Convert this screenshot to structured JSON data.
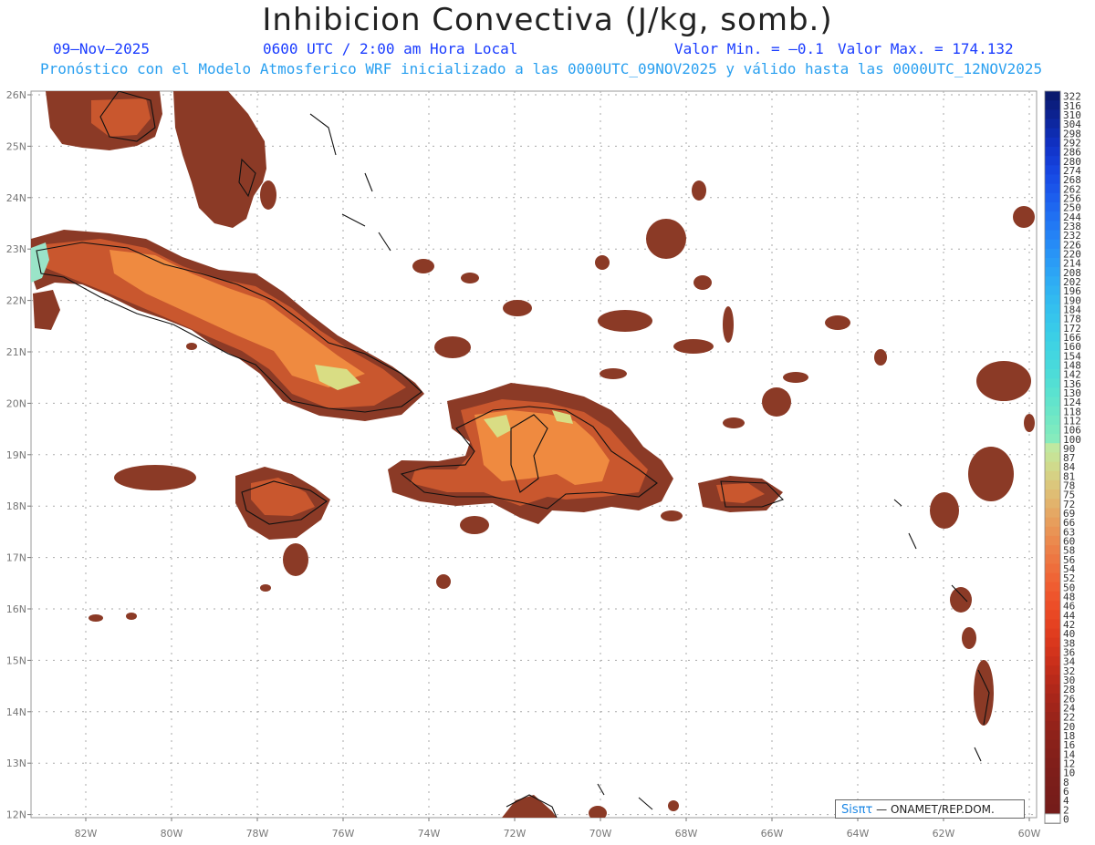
{
  "title": "Inhibicion Convectiva (J/kg, somb.)",
  "header": {
    "date": "09—Nov—2025",
    "time": "0600 UTC / 2:00 am Hora Local",
    "min": "Valor Min. = —0.1",
    "max": "Valor Max. = 174.132",
    "forecast": "Pronóstico con el Modelo Atmosferico WRF inicializado a las 0000UTC_09NOV2025 y válido hasta las  0000UTC_12NOV2025"
  },
  "axes": {
    "lat_labels": [
      "26N",
      "25N",
      "24N",
      "23N",
      "22N",
      "21N",
      "20N",
      "19N",
      "18N",
      "17N",
      "16N",
      "15N",
      "14N",
      "13N",
      "12N"
    ],
    "lon_labels": [
      "82W",
      "80W",
      "78W",
      "76W",
      "74W",
      "72W",
      "70W",
      "68W",
      "66W",
      "64W",
      "62W",
      "60W"
    ]
  },
  "colorbar": {
    "labels": [
      "322",
      "316",
      "310",
      "304",
      "298",
      "292",
      "286",
      "280",
      "274",
      "268",
      "262",
      "256",
      "250",
      "244",
      "238",
      "232",
      "226",
      "220",
      "214",
      "208",
      "202",
      "196",
      "190",
      "184",
      "178",
      "172",
      "166",
      "160",
      "154",
      "148",
      "142",
      "136",
      "130",
      "124",
      "118",
      "112",
      "106",
      "100",
      "90",
      "87",
      "84",
      "81",
      "78",
      "75",
      "72",
      "69",
      "66",
      "63",
      "60",
      "58",
      "56",
      "54",
      "52",
      "50",
      "48",
      "46",
      "44",
      "42",
      "40",
      "38",
      "36",
      "34",
      "32",
      "30",
      "28",
      "26",
      "24",
      "22",
      "20",
      "18",
      "16",
      "14",
      "12",
      "10",
      "8",
      "6",
      "4",
      "2",
      "0"
    ],
    "colors": [
      "#0a1a6e",
      "#0b1e80",
      "#0c2290",
      "#0d27a0",
      "#0e2cb0",
      "#1030c0",
      "#1236cc",
      "#143dd6",
      "#1645e0",
      "#184de6",
      "#1a55ea",
      "#1c5eee",
      "#1e67f0",
      "#2070f2",
      "#2279f4",
      "#2482f5",
      "#268bf6",
      "#2894f6",
      "#2a9cf6",
      "#2ca4f5",
      "#2eacf4",
      "#30b3f2",
      "#32baf0",
      "#34c0ee",
      "#36c5ec",
      "#38cae9",
      "#3bcfe6",
      "#3fd3e3",
      "#43d6e0",
      "#48d9dc",
      "#4ddcd8",
      "#53dfd4",
      "#5ae2d0",
      "#62e4cc",
      "#6ae6c8",
      "#73e8c4",
      "#7ceac0",
      "#86ebbd",
      "#c0e8a0",
      "#c8e296",
      "#d0da8c",
      "#d6d184",
      "#dbc77c",
      "#dfbd74",
      "#e2b36c",
      "#e5a864",
      "#e79e5c",
      "#e99455",
      "#eb8a4e",
      "#ec8048",
      "#ed7742",
      "#ee6e3c",
      "#ef6536",
      "#ef5d31",
      "#ee552c",
      "#ec4e28",
      "#e94824",
      "#e54221",
      "#e03d1f",
      "#da381d",
      "#d3341c",
      "#cb301b",
      "#c22d1a",
      "#b92a1a",
      "#b0281a",
      "#a8261a",
      "#a1251a",
      "#9a241a",
      "#94231a",
      "#8e221a",
      "#89211a",
      "#85201a",
      "#811f1a",
      "#7e1e1a",
      "#7b1e1a",
      "#791d1a",
      "#771d1a",
      "#751c1a",
      "#ffffff"
    ]
  },
  "credit": {
    "logo": "Sisπτ",
    "text": "— ONAMET/REP.DOM."
  },
  "legend_colors": {
    "land_base": "#8b3a26",
    "mid": "#c9572e",
    "high": "#ef8a40",
    "peak": "#d9dd84",
    "max": "#9ae4c8",
    "outline": "#111111"
  }
}
